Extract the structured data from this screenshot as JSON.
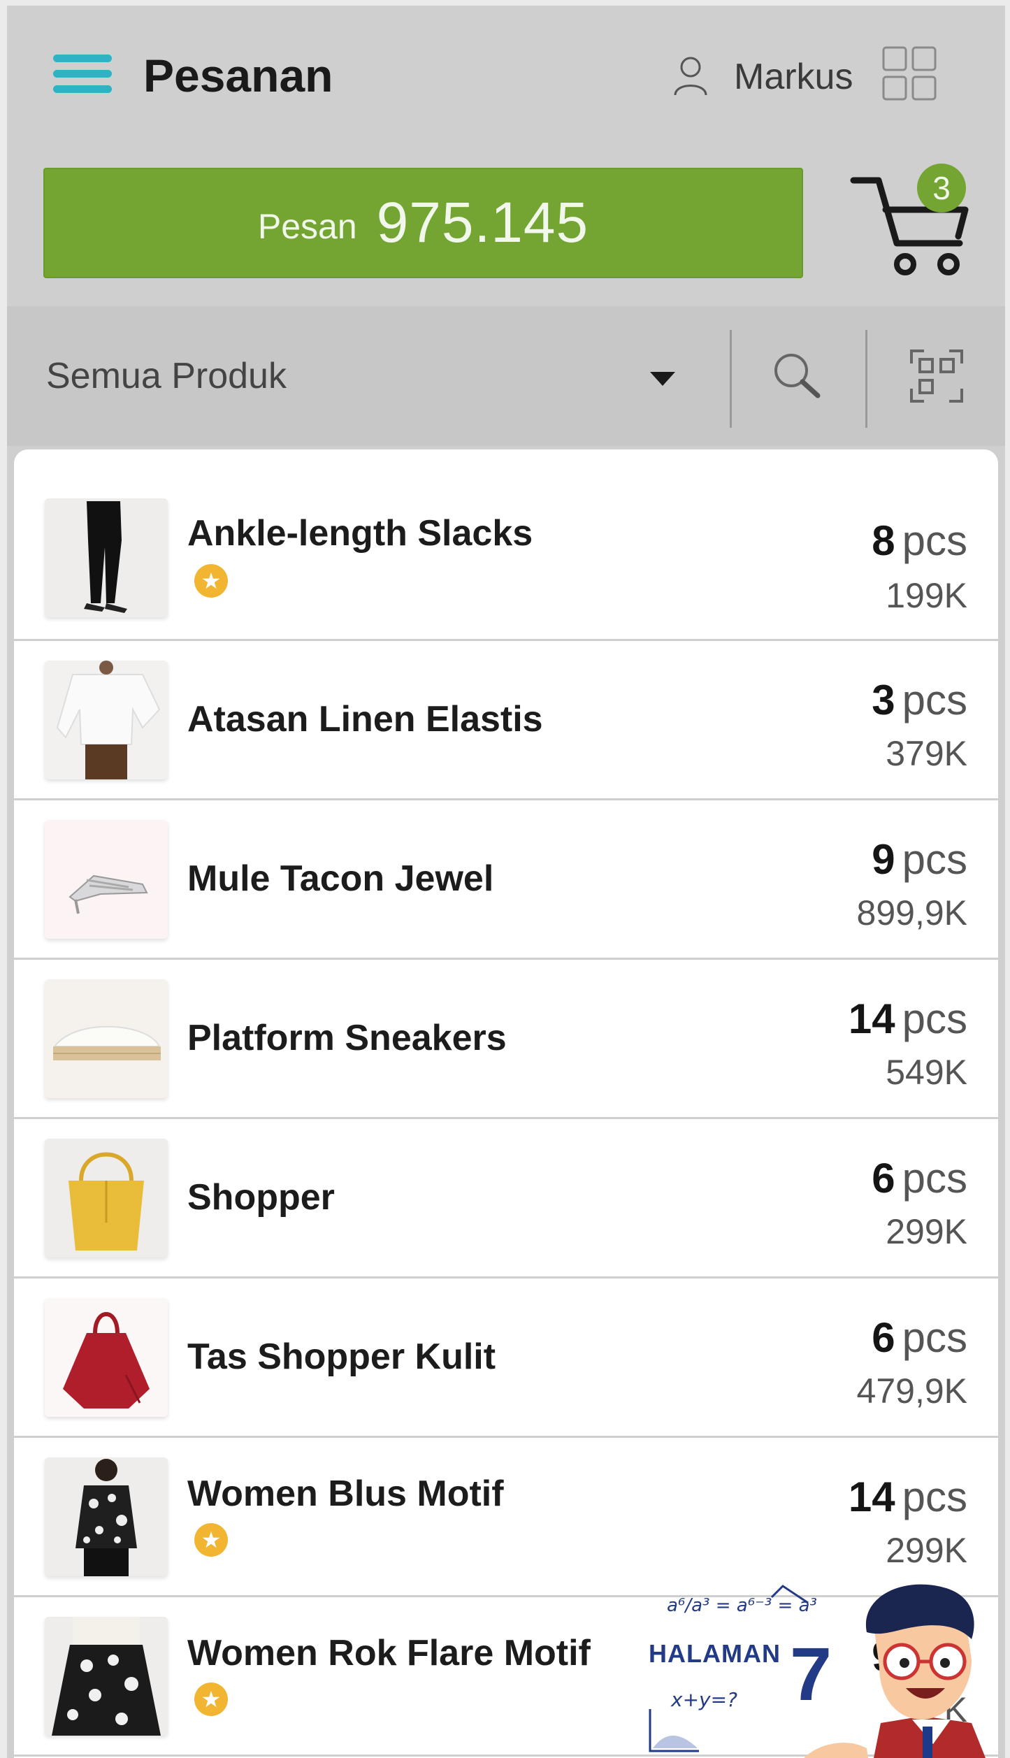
{
  "header": {
    "title": "Pesanan",
    "user": "Markus"
  },
  "order": {
    "label": "Pesan",
    "total": "975.145",
    "cart_count": "3"
  },
  "filter": {
    "category": "Semua Produk"
  },
  "products": [
    {
      "name": "Ankle-length Slacks",
      "qty": "8",
      "unit": "pcs",
      "price": "199K",
      "favorite": true,
      "thumb": "black slacks"
    },
    {
      "name": "Atasan Linen Elastis",
      "qty": "3",
      "unit": "pcs",
      "price": "379K",
      "favorite": false,
      "thumb": "white linen top"
    },
    {
      "name": "Mule Tacon Jewel",
      "qty": "9",
      "unit": "pcs",
      "price": "899,9K",
      "favorite": false,
      "thumb": "silver mule heel"
    },
    {
      "name": "Platform Sneakers",
      "qty": "14",
      "unit": "pcs",
      "price": "549K",
      "favorite": false,
      "thumb": "white platform sneaker"
    },
    {
      "name": "Shopper",
      "qty": "6",
      "unit": "pcs",
      "price": "299K",
      "favorite": false,
      "thumb": "yellow shopper bag"
    },
    {
      "name": "Tas Shopper Kulit",
      "qty": "6",
      "unit": "pcs",
      "price": "479,9K",
      "favorite": false,
      "thumb": "red leather bag"
    },
    {
      "name": "Women Blus Motif",
      "qty": "14",
      "unit": "pcs",
      "price": "299K",
      "favorite": true,
      "thumb": "patterned blouse"
    },
    {
      "name": "Women Rok Flare Motif",
      "qty": "9",
      "unit": "pcs",
      "price": "K",
      "favorite": true,
      "thumb": "patterned flare skirt"
    }
  ],
  "overlay": {
    "label": "HALAMAN",
    "number": "7",
    "formula_1": "a⁶/a³ = a⁶⁻³ = a³",
    "formula_2": "x+y=?"
  },
  "colors": {
    "accent_green": "#74a532",
    "menu_teal": "#2db3c4",
    "star": "#f1b532",
    "header_bg": "#cfcfcf"
  },
  "icons": [
    "menu-icon",
    "user-icon",
    "grid-icon",
    "cart-icon",
    "caret-down-icon",
    "search-icon",
    "qr-scan-icon",
    "star-icon"
  ]
}
